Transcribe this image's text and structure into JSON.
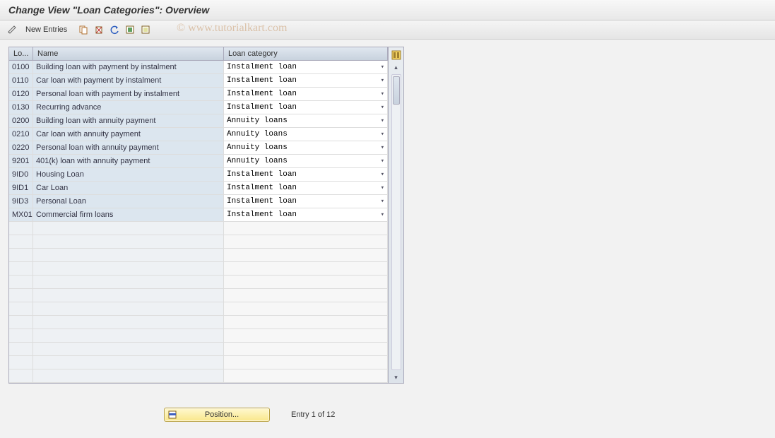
{
  "title": "Change View \"Loan Categories\": Overview",
  "watermark": "© www.tutorialkart.com",
  "toolbar": {
    "new_entries": "New Entries"
  },
  "table": {
    "headers": {
      "lo": "Lo...",
      "name": "Name",
      "cat": "Loan category"
    },
    "rows": [
      {
        "lo": "0100",
        "name": "Building loan with payment by instalment",
        "cat": "Instalment loan"
      },
      {
        "lo": "0110",
        "name": "Car loan with payment by instalment",
        "cat": "Instalment loan"
      },
      {
        "lo": "0120",
        "name": "Personal loan with payment by instalment",
        "cat": "Instalment loan"
      },
      {
        "lo": "0130",
        "name": "Recurring advance",
        "cat": "Instalment loan"
      },
      {
        "lo": "0200",
        "name": "Building loan with annuity payment",
        "cat": "Annuity loans"
      },
      {
        "lo": "0210",
        "name": "Car loan with annuity payment",
        "cat": "Annuity loans"
      },
      {
        "lo": "0220",
        "name": "Personal loan with annuity payment",
        "cat": "Annuity loans"
      },
      {
        "lo": "9201",
        "name": "401(k) loan with annuity payment",
        "cat": "Annuity loans"
      },
      {
        "lo": "9ID0",
        "name": "Housing Loan",
        "cat": "Instalment loan"
      },
      {
        "lo": "9ID1",
        "name": "Car Loan",
        "cat": "Instalment loan"
      },
      {
        "lo": "9ID3",
        "name": "Personal Loan",
        "cat": "Instalment loan"
      },
      {
        "lo": "MX01",
        "name": "Commercial firm loans",
        "cat": "Instalment loan"
      }
    ],
    "empty_rows": 12
  },
  "footer": {
    "position_label": "Position...",
    "entry_text": "Entry 1 of 12"
  }
}
